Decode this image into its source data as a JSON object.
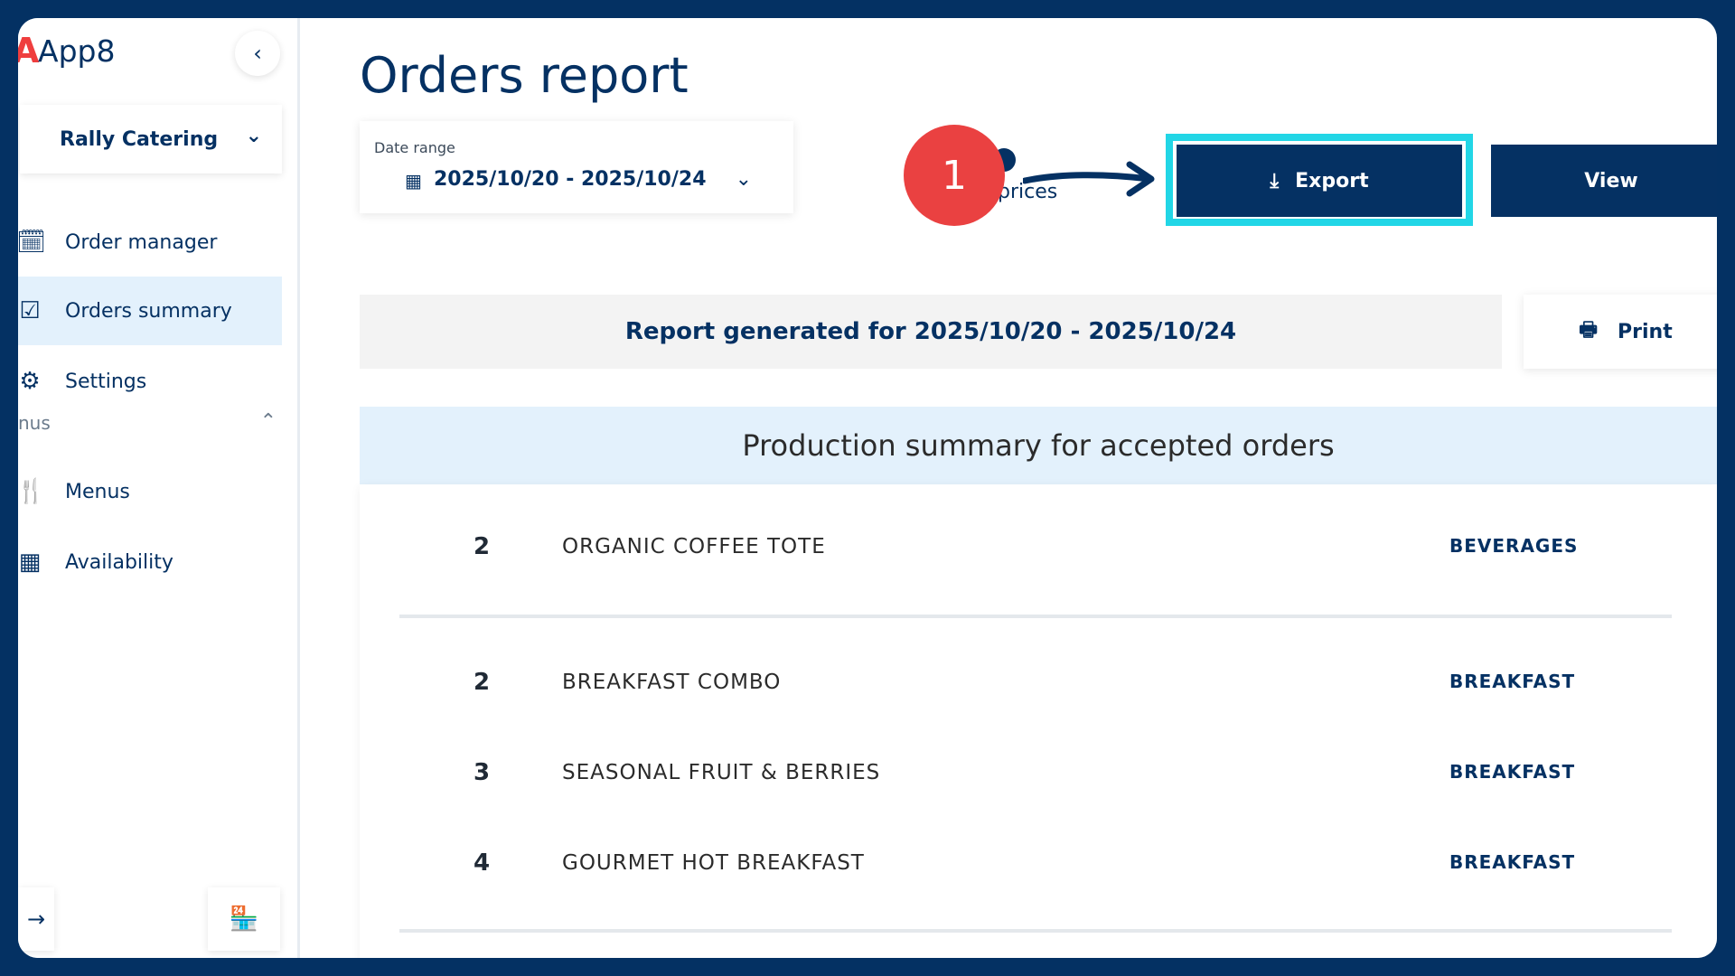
{
  "app": {
    "name": "App8"
  },
  "sidebar": {
    "company": "Rally Catering",
    "items": [
      {
        "label": "Order manager",
        "icon": "calendar-clock-icon"
      },
      {
        "label": "Orders summary",
        "icon": "clipboard-check-icon"
      },
      {
        "label": "Settings",
        "icon": "gear-icon"
      }
    ],
    "section_label": "nus",
    "section_items": [
      {
        "label": "Menus",
        "icon": "utensils-icon"
      },
      {
        "label": "Availability",
        "icon": "calendar-grid-icon"
      }
    ]
  },
  "main": {
    "title": "Orders report",
    "date_range": {
      "label": "Date range",
      "value": "2025/10/20 - 2025/10/24"
    },
    "prices_toggle_label": "prices",
    "step_badge": "1",
    "export_label": "Export",
    "view_label": "View",
    "report_banner": "Report generated for 2025/10/20 - 2025/10/24",
    "print_label": "Print",
    "summary_title": "Production summary for accepted orders",
    "rows": [
      {
        "qty": "2",
        "name": "ORGANIC COFFEE TOTE",
        "category": "BEVERAGES"
      },
      {
        "qty": "2",
        "name": "BREAKFAST COMBO",
        "category": "BREAKFAST"
      },
      {
        "qty": "3",
        "name": "SEASONAL FRUIT & BERRIES",
        "category": "BREAKFAST"
      },
      {
        "qty": "4",
        "name": "GOURMET HOT BREAKFAST",
        "category": "BREAKFAST"
      }
    ]
  },
  "colors": {
    "navy": "#053163",
    "highlight": "#22d6e6",
    "badge": "#ea4141",
    "active_bg": "#e3f1fc"
  }
}
